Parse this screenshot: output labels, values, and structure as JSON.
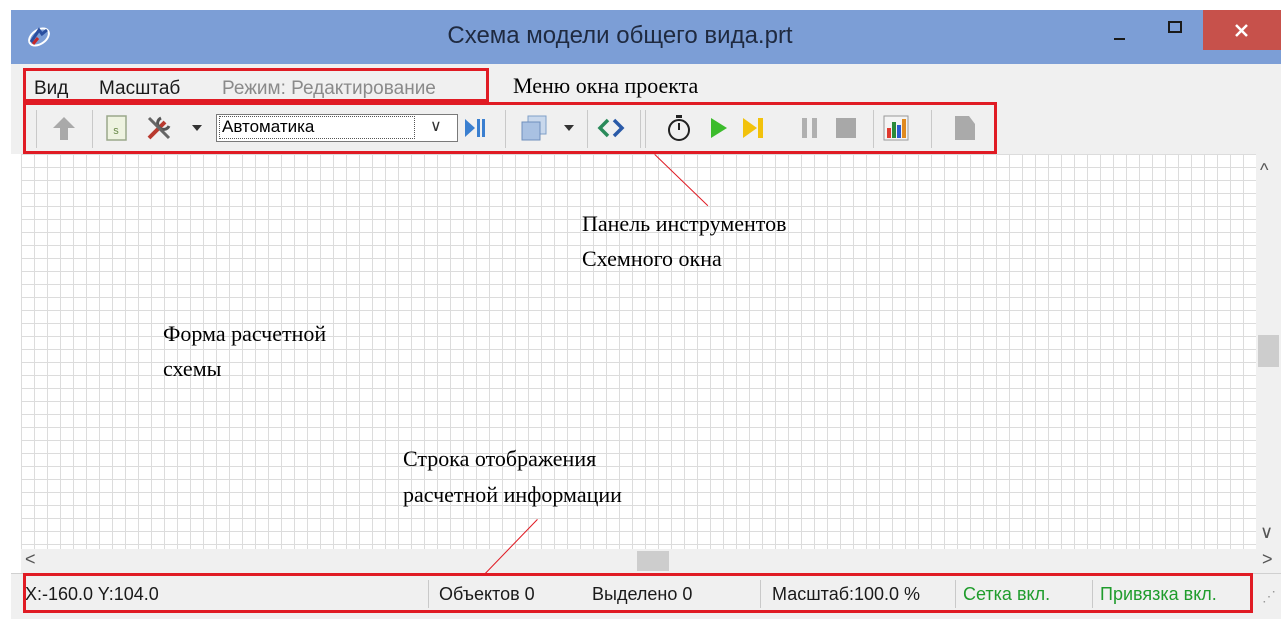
{
  "window": {
    "title": "Схема модели общего вида.prt",
    "icons": [
      "app-icon",
      "minimize-icon",
      "maximize-icon",
      "close-icon"
    ]
  },
  "menu": {
    "items": [
      "Вид",
      "Масштаб"
    ],
    "mode": "Режим: Редактирование"
  },
  "toolbar": {
    "combo_value": "Автоматика",
    "icons": [
      "up-arrow-icon",
      "script-icon",
      "tools-icon",
      "dropdown-arrow-icon",
      "step-icon",
      "windows-icon",
      "link-icon",
      "stopwatch-icon",
      "play-icon",
      "step-forward-icon",
      "pause-icon",
      "stop-icon",
      "chart-icon",
      "exit-icon"
    ]
  },
  "statusbar": {
    "coords": "X:-160.0  Y:104.0",
    "objects": "Объектов 0",
    "selected": "Выделено 0",
    "scale": "Масштаб:100.0 %",
    "grid": "Сетка вкл.",
    "snap": "Привязка вкл."
  },
  "annotations": {
    "menu": "Меню окна проекта",
    "toolbar_line1": "Панель инструментов",
    "toolbar_line2": "Схемного окна",
    "form_line1": "Форма расчетной",
    "form_line2": "схемы",
    "status_line1": "Строка отображения",
    "status_line2": "расчетной информации"
  },
  "colors": {
    "titlebar": "#7c9ed6",
    "close": "#c7514b",
    "annotation_red": "#e01b24",
    "status_green": "#1f9c2c"
  }
}
